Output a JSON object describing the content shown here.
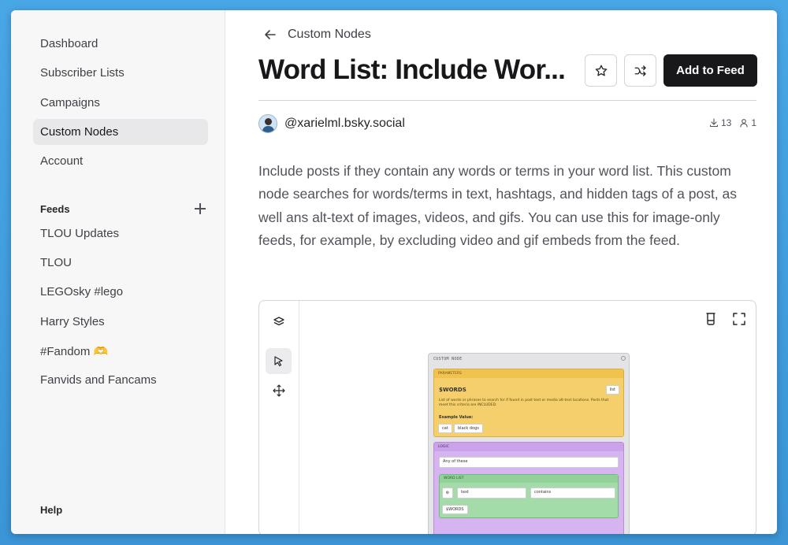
{
  "sidebar": {
    "nav": [
      "Dashboard",
      "Subscriber Lists",
      "Campaigns",
      "Custom Nodes",
      "Account"
    ],
    "active": "Custom Nodes",
    "feeds_label": "Feeds",
    "feeds": [
      "TLOU Updates",
      "TLOU",
      "LEGOsky #lego",
      "Harry Styles",
      "#Fandom 🫶",
      "Fanvids and Fancams"
    ],
    "help": "Help"
  },
  "header": {
    "breadcrumb": "Custom Nodes",
    "title": "Word List: Include Wor...",
    "add_to_feed": "Add to Feed"
  },
  "author": {
    "handle": "@xarielml.bsky.social",
    "downloads": "13",
    "users": "1"
  },
  "description": "Include posts if they contain any words or terms in your word list. This custom node searches for words/terms in text, hashtags, and hidden tags of a post, as well ans alt-text of images, videos, and gifs. You can use this for image-only feeds, for example, by excluding video and gif embeds from the feed.",
  "node": {
    "title": "CUSTOM NODE",
    "parameters_label": "PARAMETERS",
    "param_name": "$WORDS",
    "param_type": "list",
    "param_desc": "List of words or phrases to search for if found in post text or media alt-text locations. Posts that meet this criteria are INCLUDED.",
    "example_label": "Example Value:",
    "examples": [
      "cat",
      "black dogs"
    ],
    "logic_label": "LOGIC",
    "logic_mode": "Any of these",
    "wordlist_label": "WORD LIST",
    "field": "text",
    "operator": "contains",
    "value": "$WORDS"
  },
  "colors": {
    "primary_button": "#18181b",
    "params_bg": "#f5cf6b",
    "logic_bg": "#d6b4ef",
    "wordlist_bg": "#a3dba9"
  }
}
